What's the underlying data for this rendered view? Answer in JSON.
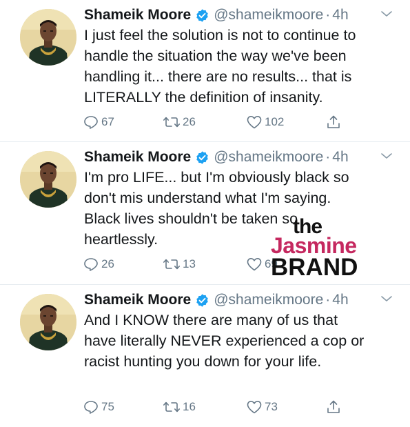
{
  "colors": {
    "text_primary": "#14171a",
    "text_secondary": "#657786",
    "verified_blue": "#1da1f2",
    "divider": "#e6ecf0",
    "watermark_pink": "#c5285f"
  },
  "icons": {
    "verified": "verified-badge-icon",
    "more": "chevron-down-icon",
    "reply": "reply-icon",
    "retweet": "retweet-icon",
    "like": "heart-icon",
    "share": "share-icon"
  },
  "tweets": [
    {
      "name": "Shameik Moore",
      "handle": "@shameikmoore",
      "separator": "·",
      "time": "4h",
      "lines": [
        "I just feel the solution is not to continue to",
        "handle the situation the way we've been",
        "handling it... there are no results... that is",
        "LITERALLY the definition of insanity."
      ],
      "replies": "67",
      "retweets": "26",
      "likes": "102"
    },
    {
      "name": "Shameik Moore",
      "handle": "@shameikmoore",
      "separator": "·",
      "time": "4h",
      "lines": [
        "I'm pro LIFE... but I'm obviously black so",
        "don't mis understand what I'm saying.",
        "Black lives shouldn't be taken so",
        "heartlessly."
      ],
      "replies": "26",
      "retweets": "13",
      "likes": "69"
    },
    {
      "name": "Shameik Moore",
      "handle": "@shameikmoore",
      "separator": "·",
      "time": "4h",
      "lines": [
        "And I KNOW there are many of us that",
        "have literally NEVER experienced a cop or",
        "racist hunting you down for your life."
      ],
      "replies": "75",
      "retweets": "16",
      "likes": "73"
    }
  ],
  "watermark": {
    "line1": "the",
    "line2": "Jasmine",
    "line3": "BRAND"
  }
}
